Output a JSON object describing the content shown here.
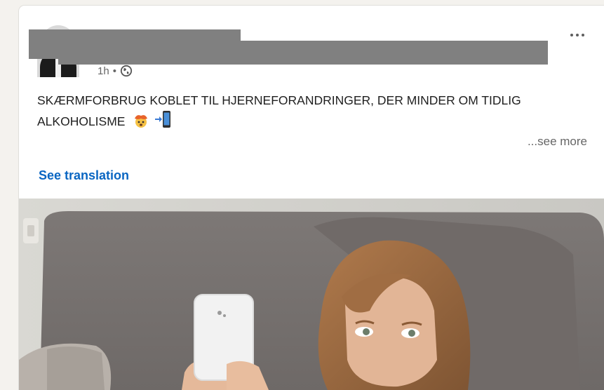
{
  "post": {
    "time": "1h",
    "separator": "•",
    "visibility_icon": "globe-icon",
    "text": "SKÆRMFORBRUG KOBLET TIL HJERNEFORANDRINGER, DER MINDER OM TIDLIG ALKOHOLISME",
    "emojis": [
      "exploding-head-emoji",
      "phone-with-arrow-emoji"
    ],
    "see_more_label": "...see more",
    "see_translation_label": "See translation",
    "more_options_icon": "ellipsis-icon"
  },
  "colors": {
    "link_blue": "#0a66c2",
    "text_primary": "#1f1f1f",
    "text_secondary": "#666666",
    "redaction_gray": "#808080"
  }
}
